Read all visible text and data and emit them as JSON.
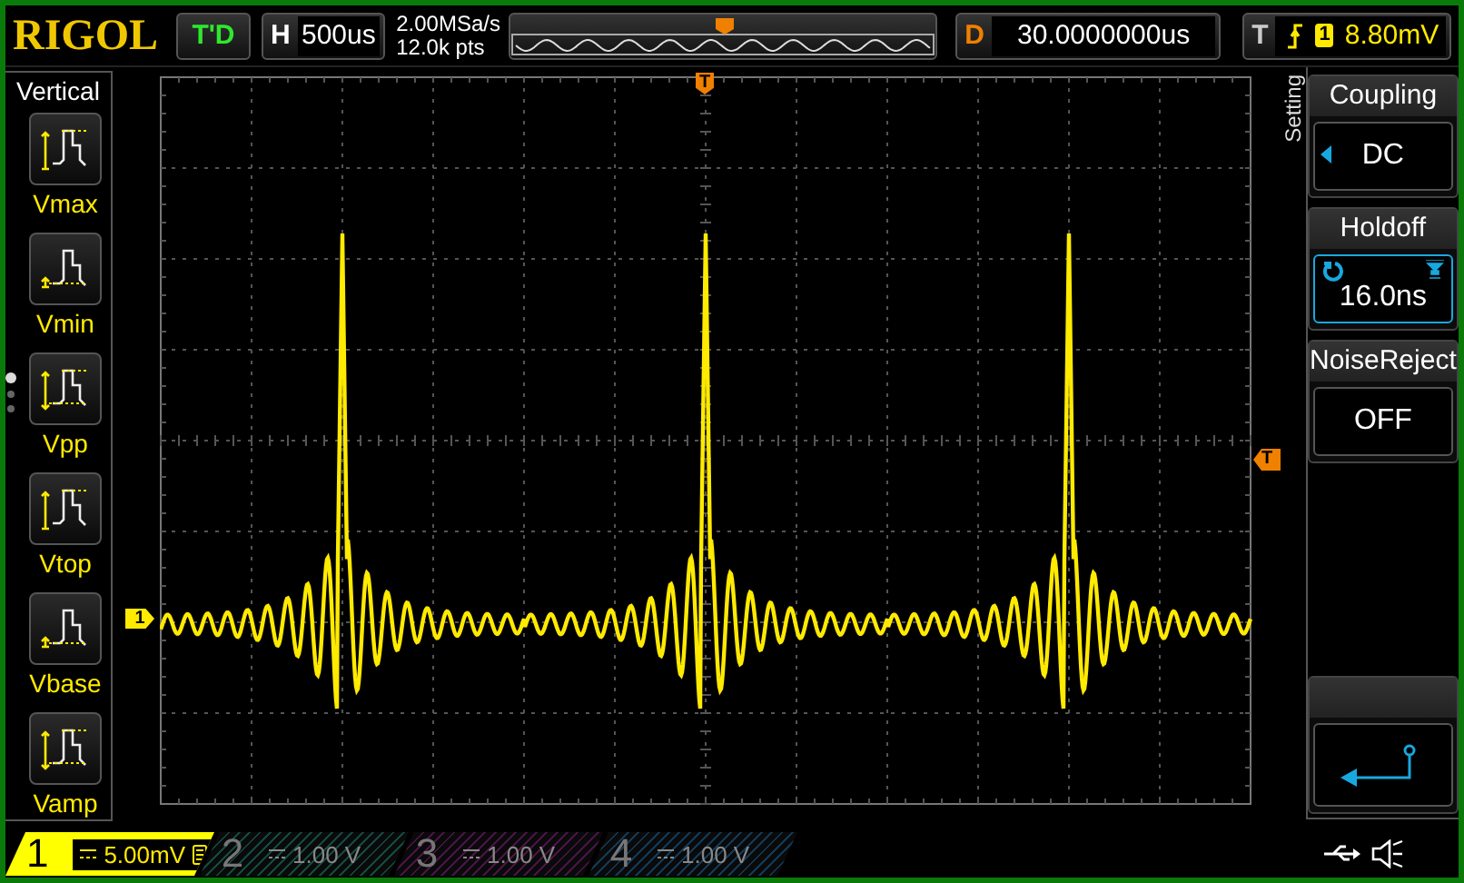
{
  "header": {
    "logo": "RIGOL",
    "run_status": "T'D",
    "horizontal": {
      "label": "H",
      "value": "500us"
    },
    "sample_rate": "2.00MSa/s",
    "memory_depth": "12.0k pts",
    "delay": {
      "label": "D",
      "value": "30.0000000us"
    },
    "trigger": {
      "label": "T",
      "source": "1",
      "level": "8.80mV"
    }
  },
  "left_menu": {
    "title": "Vertical",
    "items": [
      {
        "label": "Vmax"
      },
      {
        "label": "Vmin"
      },
      {
        "label": "Vpp"
      },
      {
        "label": "Vtop"
      },
      {
        "label": "Vbase"
      },
      {
        "label": "Vamp"
      }
    ],
    "pages": [
      {
        "selected": true
      },
      {
        "selected": false
      },
      {
        "selected": false
      }
    ]
  },
  "display": {
    "trigger_position_marker": "T",
    "trigger_level_marker": "T",
    "channel_marker": "1"
  },
  "right_menu": {
    "tab": "Setting",
    "items": [
      {
        "kind": "select",
        "title": "Coupling",
        "value": "DC",
        "selected": false
      },
      {
        "kind": "knob",
        "title": "Holdoff",
        "value": "16.0ns",
        "selected": true
      },
      {
        "kind": "toggle",
        "title": "NoiseReject",
        "value": "OFF",
        "selected": false
      },
      {
        "kind": "back"
      }
    ]
  },
  "channels": [
    {
      "number": "1",
      "scale": "5.00mV",
      "on": true,
      "color": "#ffff00"
    },
    {
      "number": "2",
      "scale": "1.00 V",
      "on": false,
      "color": "#134a40"
    },
    {
      "number": "3",
      "scale": "1.00 V",
      "on": false,
      "color": "#4a1448"
    },
    {
      "number": "4",
      "scale": "1.00 V",
      "on": false,
      "color": "#123a58"
    }
  ]
}
